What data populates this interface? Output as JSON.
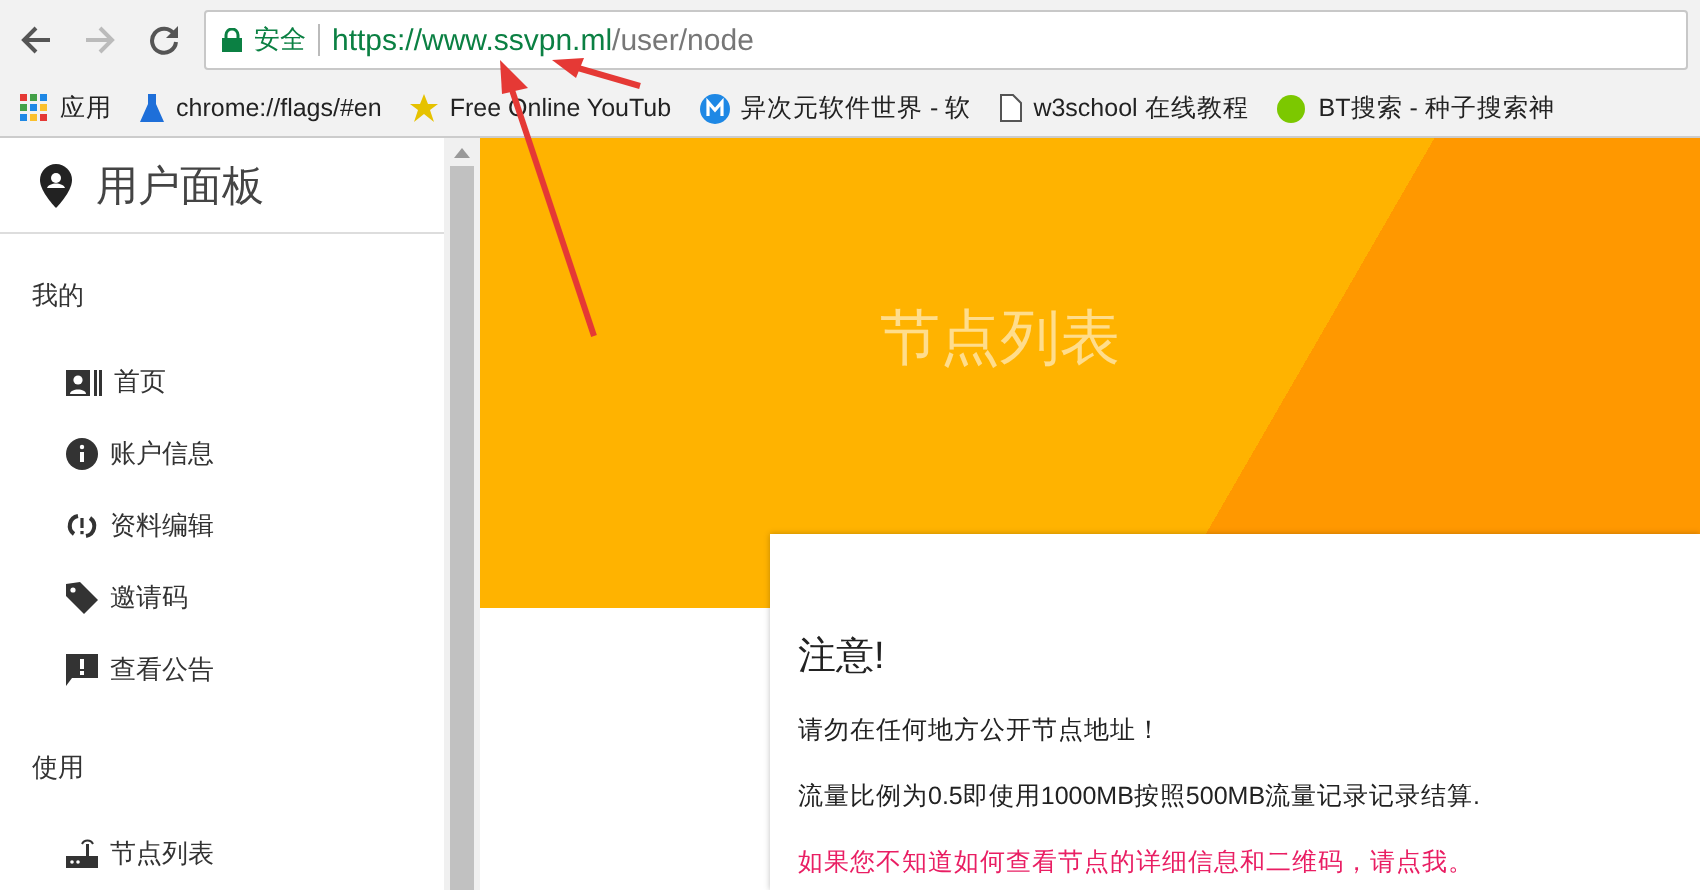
{
  "browser": {
    "security_label": "安全",
    "url_host": "https://www.ssvpn.ml",
    "url_path": "/user/node"
  },
  "bookmarks": [
    {
      "kind": "apps",
      "label": "应用"
    },
    {
      "kind": "flask",
      "label": "chrome://flags/#en"
    },
    {
      "kind": "star",
      "label": "Free Online YouTub"
    },
    {
      "kind": "logo",
      "label": "异次元软件世界 - 软"
    },
    {
      "kind": "page",
      "label": "w3school 在线教程"
    },
    {
      "kind": "ball",
      "label": "BT搜索 - 种子搜索神"
    }
  ],
  "sidebar": {
    "title": "用户面板",
    "sections": [
      {
        "heading": "我的",
        "items": [
          {
            "label": "首页"
          },
          {
            "label": "账户信息"
          },
          {
            "label": "资料编辑"
          },
          {
            "label": "邀请码"
          },
          {
            "label": "查看公告"
          }
        ]
      },
      {
        "heading": "使用",
        "items": [
          {
            "label": "节点列表"
          }
        ]
      }
    ]
  },
  "header": {
    "title": "节点列表"
  },
  "notice": {
    "title": "注意!",
    "lines": [
      {
        "kind": "plain",
        "text": "请勿在任何地方公开节点地址！"
      },
      {
        "kind": "plain",
        "text": "流量比例为0.5即使用1000MB按照500MB流量记录记录结算."
      },
      {
        "kind": "link",
        "text": "如果您不知道如何查看节点的详细信息和二维码，请点我。"
      }
    ]
  }
}
